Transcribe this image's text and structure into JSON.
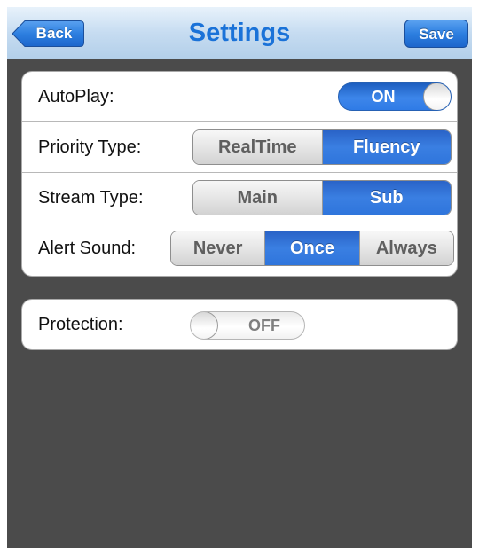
{
  "nav": {
    "title": "Settings",
    "back_label": "Back",
    "save_label": "Save"
  },
  "settings": {
    "autoplay": {
      "label": "AutoPlay:",
      "state": "ON"
    },
    "priority_type": {
      "label": "Priority Type:",
      "options": [
        "RealTime",
        "Fluency"
      ],
      "selected": "Fluency"
    },
    "stream_type": {
      "label": "Stream Type:",
      "options": [
        "Main",
        "Sub"
      ],
      "selected": "Sub"
    },
    "alert_sound": {
      "label": "Alert Sound:",
      "options": [
        "Never",
        "Once",
        "Always"
      ],
      "selected": "Once"
    },
    "protection": {
      "label": "Protection:",
      "state": "OFF"
    }
  },
  "colors": {
    "accent": "#2f7be6",
    "title": "#1a72d8",
    "background": "#4b4b4b"
  }
}
